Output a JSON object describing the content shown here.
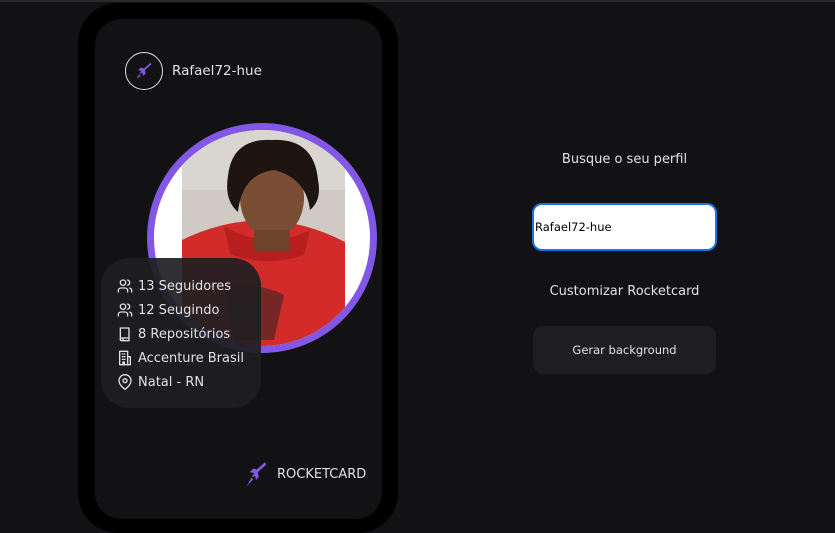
{
  "card": {
    "username": "Rafael72-hue",
    "stats": [
      {
        "icon": "users-icon",
        "label": "13 Seguidores"
      },
      {
        "icon": "users-icon",
        "label": "12 Seugindo"
      },
      {
        "icon": "book-icon",
        "label": "8 Repositórios"
      },
      {
        "icon": "building-icon",
        "label": "Accenture Brasil"
      },
      {
        "icon": "map-pin-icon",
        "label": "Natal - RN"
      }
    ],
    "brand": "ROCKETCARD"
  },
  "controls": {
    "search_title": "Busque o seu perfil",
    "search_value": "Rafael72-hue",
    "customize_title": "Customizar Rocketcard",
    "generate_button": "Gerar background"
  },
  "colors": {
    "background": "#121214",
    "accent": "#8257e5",
    "input_focus": "#1a73e8"
  }
}
